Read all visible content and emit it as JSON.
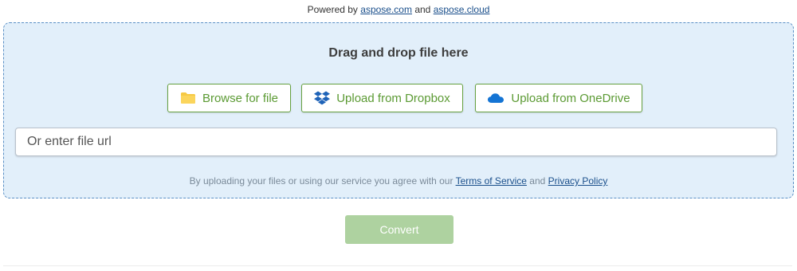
{
  "powered": {
    "prefix": "Powered by",
    "link1": "aspose.com",
    "and": "and",
    "link2": "aspose.cloud"
  },
  "dropzone": {
    "title": "Drag and drop file here",
    "buttons": {
      "browse": {
        "label": "Browse for file",
        "icon": "folder-icon"
      },
      "dropbox": {
        "label": "Upload from Dropbox",
        "icon": "dropbox-icon"
      },
      "onedrive": {
        "label": "Upload from OneDrive",
        "icon": "onedrive-icon"
      }
    },
    "url_input": {
      "placeholder": "Or enter file url",
      "value": ""
    },
    "terms": {
      "text": "By uploading your files or using our service you agree with our",
      "tos": "Terms of Service",
      "and": "and",
      "privacy": "Privacy Policy"
    }
  },
  "convert": {
    "label": "Convert"
  },
  "colors": {
    "accent_green": "#5b9a33",
    "dropzone_bg": "#e2effa",
    "convert_bg": "#aed2a0",
    "link": "#1a4f8b"
  }
}
